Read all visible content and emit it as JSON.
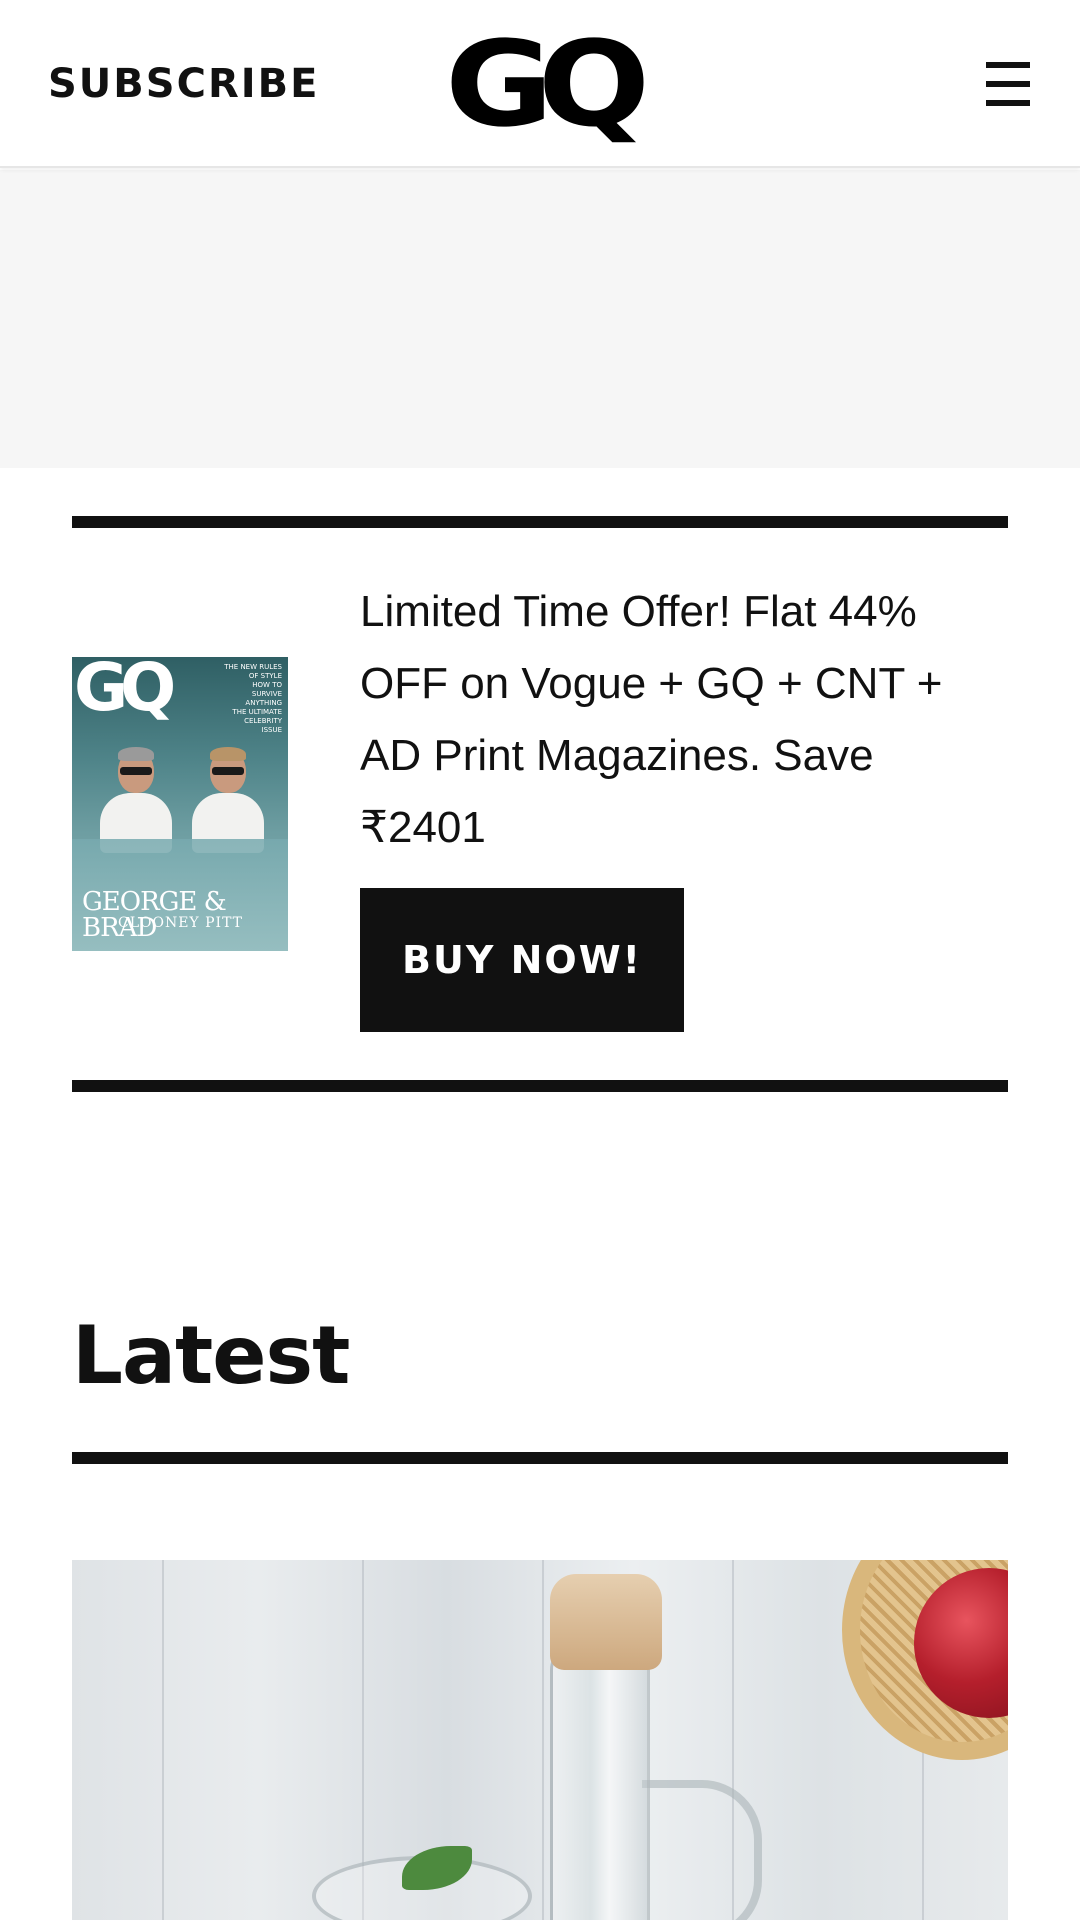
{
  "header": {
    "subscribe_label": "SUBSCRIBE",
    "logo_text": "GQ",
    "menu_icon": "hamburger-menu-icon"
  },
  "promo": {
    "cover": {
      "masthead": "GQ",
      "tagline": "THE NEW RULES\nOF STYLE\nHOW TO\nSURVIVE\nANYTHING\nTHE ULTIMATE\nCELEBRITY\nISSUE",
      "names": "GEORGE & BRAD",
      "subnames": "CLOONEY    PITT"
    },
    "text": "Limited Time Offer! Flat 44% OFF on Vogue + GQ + CNT + AD Print Magazines. Save ₹2401",
    "button_label": "BUY NOW!"
  },
  "latest": {
    "heading": "Latest"
  },
  "colors": {
    "text": "#111111",
    "button_bg": "#111111",
    "button_text": "#ffffff",
    "ad_slot_bg": "#f6f6f6",
    "page_bg": "#ffffff"
  }
}
